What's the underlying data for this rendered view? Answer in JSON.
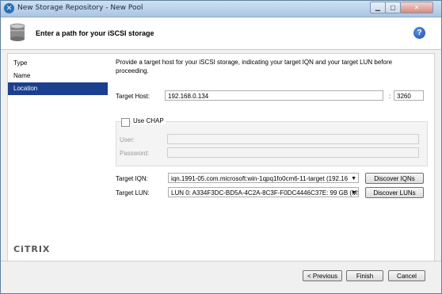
{
  "window": {
    "title": "New Storage Repository - New Pool"
  },
  "header": {
    "title": "Enter a path for your iSCSI storage"
  },
  "sidebar": {
    "items": [
      {
        "label": "Type",
        "active": false
      },
      {
        "label": "Name",
        "active": false
      },
      {
        "label": "Location",
        "active": true
      }
    ],
    "logo": "CiTRIX"
  },
  "main": {
    "description": "Provide a target host for your iSCSI storage, indicating your target IQN and your target LUN before proceeding.",
    "target_host_label": "Target Host:",
    "target_host_value": "192.168.0.134",
    "port_separator": ":",
    "port_value": "3260",
    "chap": {
      "label": "Use CHAP",
      "checked": false,
      "user_label": "User:",
      "password_label": "Password:",
      "user_value": "",
      "password_value": ""
    },
    "target_iqn_label": "Target IQN:",
    "target_iqn_value": "iqn.1991-05.com.microsoft:win-1qpq1fo0cm6-11-target (192.16",
    "discover_iqns_label": "Discover IQNs",
    "target_lun_label": "Target LUN:",
    "target_lun_value": "LUN 0: A334F3DC-BD5A-4C2A-8C3F-F0DC4446C37E: 99 GB (MSI",
    "discover_luns_label": "Discover LUNs"
  },
  "footer": {
    "previous_label": "< Previous",
    "finish_label": "Finish",
    "cancel_label": "Cancel"
  },
  "colors": {
    "selection": "#1b3f8f",
    "titlebar": "#bcd3ea"
  }
}
